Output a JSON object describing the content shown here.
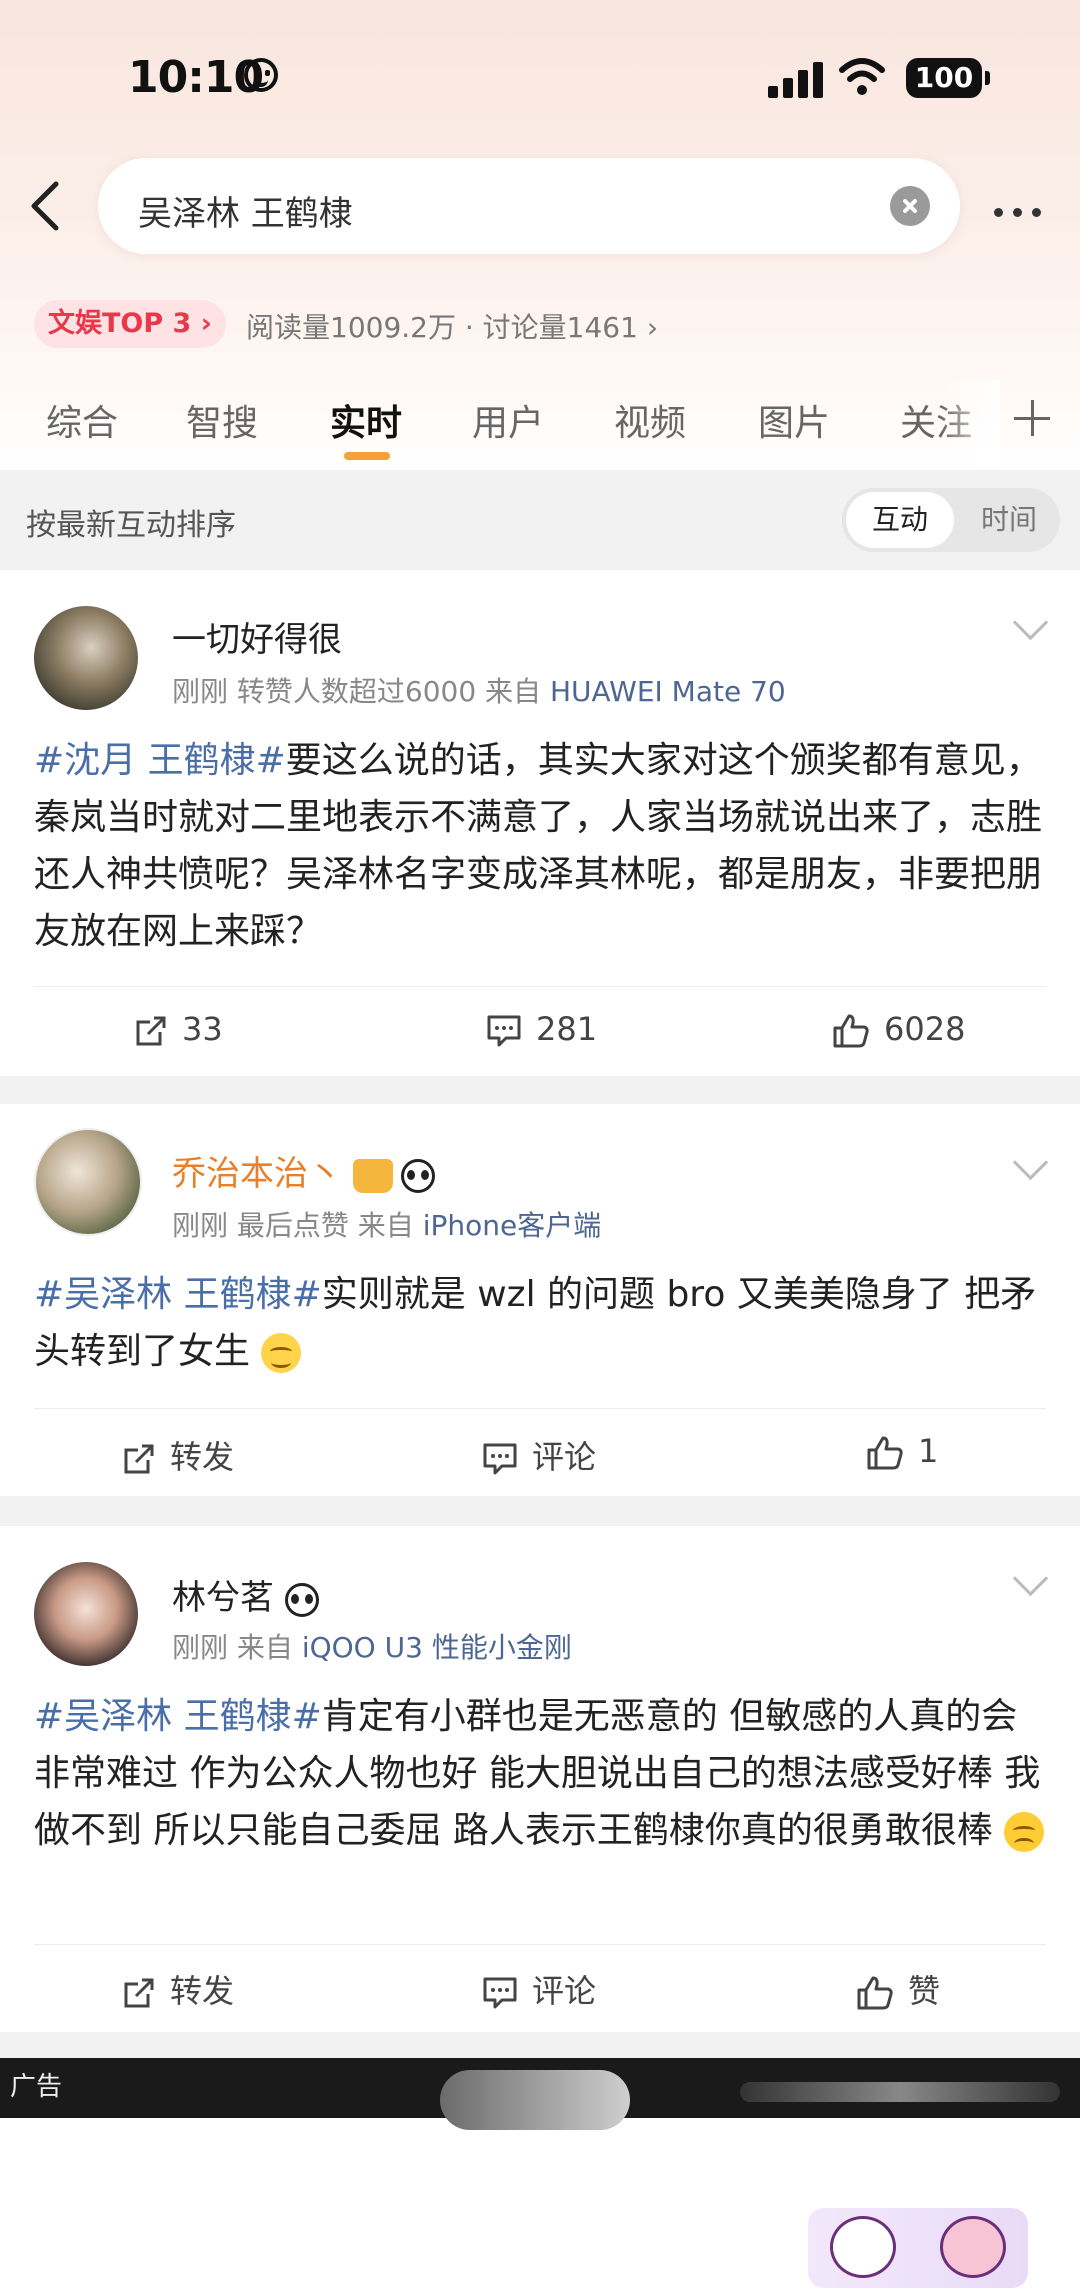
{
  "status_bar": {
    "time": "10:10",
    "battery": "100"
  },
  "search": {
    "query": "吴泽林 王鹤棣"
  },
  "topic": {
    "badge": "文娱TOP 3 ›",
    "stats": "阅读量1009.2万 · 讨论量1461 ›"
  },
  "tabs": [
    "综合",
    "智搜",
    "实时",
    "用户",
    "视频",
    "图片",
    "关注"
  ],
  "sort": {
    "label": "按最新互动排序",
    "options": [
      "互动",
      "时间"
    ]
  },
  "posts": [
    {
      "username": "一切好得很",
      "meta_prefix": "刚刚  转赞人数超过6000  来自",
      "source": "HUAWEI Mate 70",
      "hashtag": "#沈月 王鹤棣#",
      "text": "要这么说的话，其实大家对这个颁奖都有意见，秦岚当时就对二里地表示不满意了，人家当场就说出来了，志胜还人神共愤呢？吴泽林名字变成泽其林呢，都是朋友，非要把朋友放在网上来踩？",
      "repost": "33",
      "comment": "281",
      "like": "6028"
    },
    {
      "username": "乔治本治丶",
      "meta_prefix": "刚刚  最后点赞  来自",
      "source": "iPhone客户端",
      "hashtag": "#吴泽林 王鹤棣#",
      "text": "实则就是 wzl 的问题 bro 又美美隐身了 把矛头转到了女生",
      "repost": "转发",
      "comment": "评论",
      "like": "1"
    },
    {
      "username": "林兮茗",
      "meta_prefix": "刚刚  来自",
      "source": "iQOO U3 性能小金刚",
      "hashtag": "#吴泽林 王鹤棣#",
      "text": "肯定有小群也是无恶意的 但敏感的人真的会非常难过 作为公众人物也好 能大胆说出自己的想法感受好棒 我做不到 所以只能自己委屈 路人表示王鹤棣你真的很勇敢很棒",
      "repost": "转发",
      "comment": "评论",
      "like": "赞"
    }
  ],
  "ad": {
    "label": "广告"
  },
  "icons": [
    "back-arrow-icon",
    "clear-icon",
    "more-icon",
    "chevron-down-icon",
    "repost-icon",
    "comment-icon",
    "like-icon",
    "smile-icon",
    "cry-icon",
    "panda-icon",
    "crown-icon"
  ]
}
